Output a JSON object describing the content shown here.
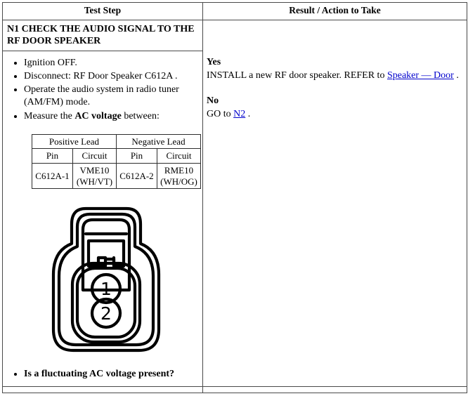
{
  "table": {
    "headers": {
      "test_step": "Test Step",
      "result_action": "Result / Action to Take"
    },
    "step": {
      "title": "N1 CHECK THE AUDIO SIGNAL TO THE RF DOOR SPEAKER",
      "bullets": [
        {
          "pre": "Ignition OFF.",
          "bold": "",
          "post": ""
        },
        {
          "pre": "Disconnect: RF Door Speaker C612A .",
          "bold": "",
          "post": ""
        },
        {
          "pre": "Operate the audio system in radio tuner (AM/FM) mode.",
          "bold": "",
          "post": ""
        },
        {
          "pre": "Measure the ",
          "bold": "AC voltage",
          "post": " between:"
        }
      ],
      "question": "Is a fluctuating AC voltage present?"
    },
    "leads_table": {
      "group_headers": [
        "Positive Lead",
        "Negative Lead"
      ],
      "sub_headers": [
        "Pin",
        "Circuit",
        "Pin",
        "Circuit"
      ],
      "row": [
        "C612A-1",
        "VME10 (WH/VT)",
        "C612A-2",
        "RME10 (WH/OG)"
      ]
    },
    "connector": {
      "name": "C612A connector face view",
      "pins": [
        "1",
        "2"
      ]
    },
    "result": {
      "yes_label": "Yes",
      "yes_text_before_link": "INSTALL a new RF door speaker. REFER to ",
      "yes_link": "Speaker — Door",
      "yes_text_after_link": " .",
      "no_label": "No",
      "no_text_before_link": "GO to ",
      "no_link": "N2",
      "no_text_after_link": " ."
    }
  },
  "colors": {
    "link": "#0000cc",
    "border": "#4a4a4a",
    "text": "#000000",
    "background": "#ffffff"
  }
}
